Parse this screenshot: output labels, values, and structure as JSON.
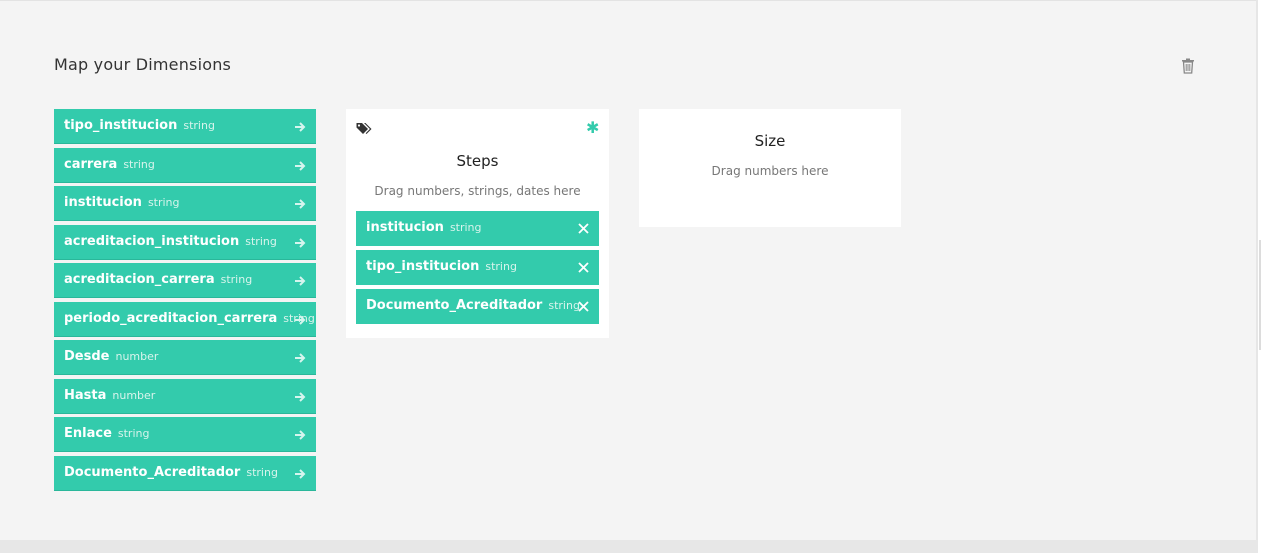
{
  "section": {
    "title": "Map your Dimensions",
    "delete_icon": "trash-icon"
  },
  "dimensions": [
    {
      "name": "tipo_institucion",
      "type": "string"
    },
    {
      "name": "carrera",
      "type": "string"
    },
    {
      "name": "institucion",
      "type": "string"
    },
    {
      "name": "acreditacion_institucion",
      "type": "string"
    },
    {
      "name": "acreditacion_carrera",
      "type": "string"
    },
    {
      "name": "periodo_acreditacion_carrera",
      "type": "string"
    },
    {
      "name": "Desde",
      "type": "number"
    },
    {
      "name": "Hasta",
      "type": "number"
    },
    {
      "name": "Enlace",
      "type": "string"
    },
    {
      "name": "Documento_Acreditador",
      "type": "string"
    }
  ],
  "steps": {
    "title": "Steps",
    "hint": "Drag numbers, strings, dates here",
    "required_marker": "✱",
    "icon": "tags-icon",
    "mapped": [
      {
        "name": "institucion",
        "type": "string"
      },
      {
        "name": "tipo_institucion",
        "type": "string"
      },
      {
        "name": "Documento_Acreditador",
        "type": "string"
      }
    ]
  },
  "size": {
    "title": "Size",
    "hint": "Drag numbers here"
  },
  "colors": {
    "accent": "#33cbac",
    "background": "#f4f4f4",
    "card": "#ffffff"
  }
}
